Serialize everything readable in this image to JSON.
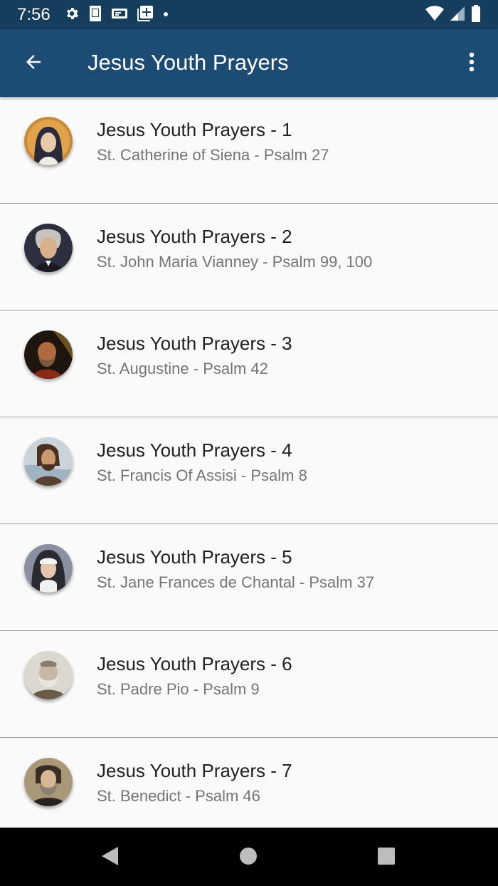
{
  "status_bar": {
    "time": "7:56",
    "left_icons": [
      "settings-icon",
      "sim-card-icon",
      "cast-icon",
      "add-box-icon",
      "dot-icon"
    ],
    "right_icons": [
      "wifi-icon",
      "signal-icon",
      "battery-icon"
    ]
  },
  "app_bar": {
    "title": "Jesus Youth Prayers",
    "back_icon": "arrow-back-icon",
    "menu_icon": "more-vert-icon"
  },
  "prayers": [
    {
      "title": "Jesus Youth Prayers - 1",
      "subtitle": "St. Catherine of Siena - Psalm 27"
    },
    {
      "title": "Jesus Youth Prayers - 2",
      "subtitle": "St. John Maria Vianney - Psalm 99, 100"
    },
    {
      "title": "Jesus Youth Prayers - 3",
      "subtitle": "St. Augustine - Psalm 42"
    },
    {
      "title": "Jesus Youth Prayers - 4",
      "subtitle": "St. Francis Of Assisi - Psalm 8"
    },
    {
      "title": "Jesus Youth Prayers - 5",
      "subtitle": "St. Jane Frances de Chantal - Psalm 37"
    },
    {
      "title": "Jesus Youth Prayers - 6",
      "subtitle": "St. Padre Pio - Psalm 9"
    },
    {
      "title": "Jesus Youth Prayers - 7",
      "subtitle": "St. Benedict - Psalm 46"
    }
  ],
  "nav_bar": {
    "back_icon": "nav-back-icon",
    "home_icon": "nav-home-icon",
    "recents_icon": "nav-recents-icon"
  },
  "colors": {
    "status_bar": "#153d5e",
    "app_bar": "#1c4b74",
    "background": "#fafafa",
    "title_text": "#212121",
    "subtitle_text": "#757575"
  }
}
